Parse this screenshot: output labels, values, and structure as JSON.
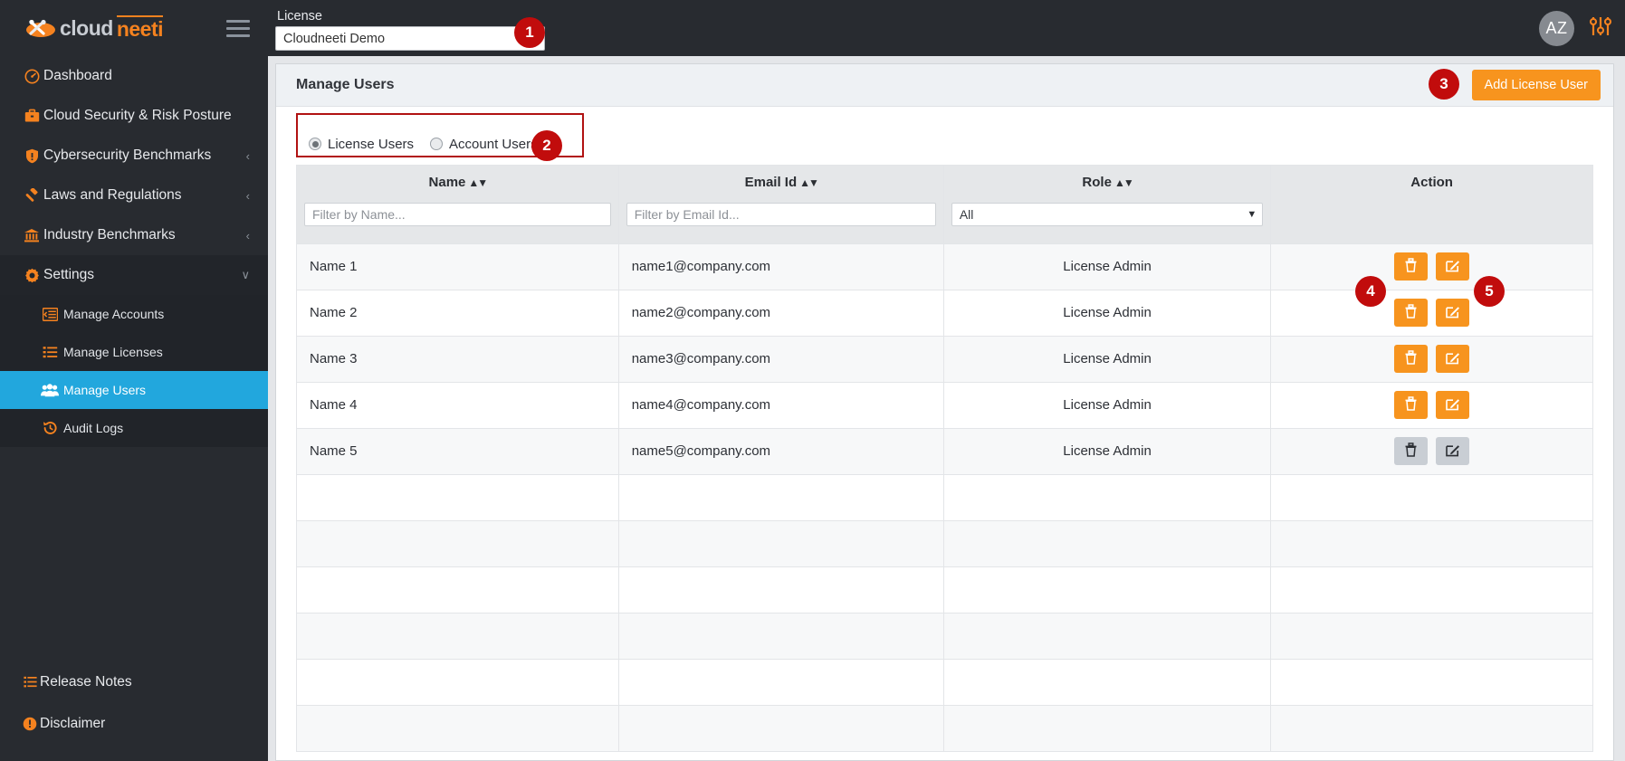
{
  "brand": {
    "part1": "cloud",
    "part2": "neeti",
    "logo_icon": "cloud-tools-logo-icon"
  },
  "topbar": {
    "license_label": "License",
    "license_value": "Cloudneeti Demo",
    "avatar_initials": "AZ",
    "settings_icon": "sliders-icon",
    "hamburger_icon": "hamburger-icon"
  },
  "sidebar": {
    "items": [
      {
        "label": "Dashboard",
        "icon": "gauge-icon",
        "caret": "",
        "active": false
      },
      {
        "label": "Cloud Security & Risk Posture",
        "icon": "briefcase-icon",
        "caret": "",
        "active": false
      },
      {
        "label": "Cybersecurity Benchmarks",
        "icon": "shield-icon",
        "caret": "‹",
        "active": false
      },
      {
        "label": "Laws and Regulations",
        "icon": "gavel-icon",
        "caret": "‹",
        "active": false
      },
      {
        "label": "Industry Benchmarks",
        "icon": "bank-icon",
        "caret": "‹",
        "active": false
      },
      {
        "label": "Settings",
        "icon": "gear-icon",
        "caret": "∨",
        "active": false
      }
    ],
    "sub_items": [
      {
        "label": "Manage Accounts",
        "icon": "list-indent-icon",
        "active": false
      },
      {
        "label": "Manage Licenses",
        "icon": "list-icon",
        "active": false
      },
      {
        "label": "Manage Users",
        "icon": "users-icon",
        "active": true
      },
      {
        "label": "Audit Logs",
        "icon": "history-icon",
        "active": false
      }
    ],
    "bottom_items": [
      {
        "label": "Release Notes",
        "icon": "notes-icon"
      },
      {
        "label": "Disclaimer",
        "icon": "exclamation-circle-icon"
      }
    ]
  },
  "panel": {
    "title": "Manage Users",
    "add_button": "Add License User",
    "radio_options": [
      {
        "label": "License Users",
        "selected": true
      },
      {
        "label": "Account Users",
        "selected": false
      }
    ]
  },
  "table": {
    "columns": [
      {
        "label": "Name",
        "sortable": true
      },
      {
        "label": "Email Id",
        "sortable": true
      },
      {
        "label": "Role",
        "sortable": true
      },
      {
        "label": "Action",
        "sortable": false
      }
    ],
    "filters": {
      "name_placeholder": "Filter by Name...",
      "name_value": "",
      "email_placeholder": "Filter by Email Id...",
      "email_value": "",
      "role_value": "All"
    },
    "rows": [
      {
        "name": "Name 1",
        "email": "name1@company.com",
        "role": "License Admin",
        "actions_enabled": true
      },
      {
        "name": "Name 2",
        "email": "name2@company.com",
        "role": "License Admin",
        "actions_enabled": true
      },
      {
        "name": "Name 3",
        "email": "name3@company.com",
        "role": "License Admin",
        "actions_enabled": true
      },
      {
        "name": "Name 4",
        "email": "name4@company.com",
        "role": "License Admin",
        "actions_enabled": true
      },
      {
        "name": "Name 5",
        "email": "name5@company.com",
        "role": "License Admin",
        "actions_enabled": false
      }
    ],
    "empty_row_count": 6,
    "action_icons": {
      "delete": "trash-icon",
      "edit": "edit-square-icon"
    }
  },
  "annotations": [
    {
      "number": "1",
      "target": "license-dropdown"
    },
    {
      "number": "2",
      "target": "user-type-radio-group"
    },
    {
      "number": "3",
      "target": "add-license-user-button"
    },
    {
      "number": "4",
      "target": "delete-user-button"
    },
    {
      "number": "5",
      "target": "edit-user-button"
    }
  ],
  "colors": {
    "sidebar_bg": "#282b30",
    "sidebar_active": "#22a7dd",
    "accent_orange": "#f7941e",
    "annotation_red": "#c10c0c"
  }
}
